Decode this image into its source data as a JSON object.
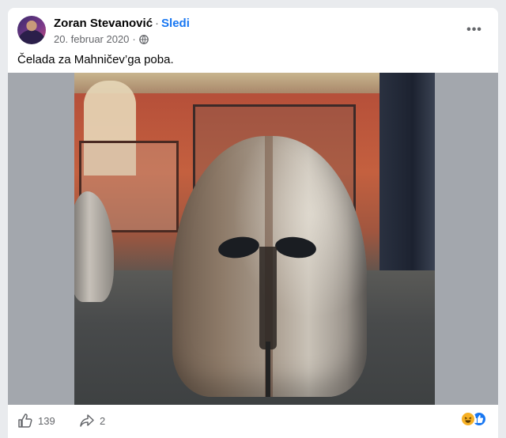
{
  "post": {
    "author": "Zoran Stevanović",
    "separator": "·",
    "follow_label": "Sledi",
    "date": "20. februar 2020",
    "privacy_icon": "globe-icon",
    "more_label": "•••",
    "caption": "Čelada za Mahničev’ga poba."
  },
  "media": {
    "type": "video"
  },
  "footer": {
    "like_count": "139",
    "share_count": "2",
    "reactions": [
      "haha",
      "like"
    ]
  },
  "colors": {
    "accent": "#1877f2",
    "secondary_text": "#65676b",
    "haha": "#f7b125"
  }
}
